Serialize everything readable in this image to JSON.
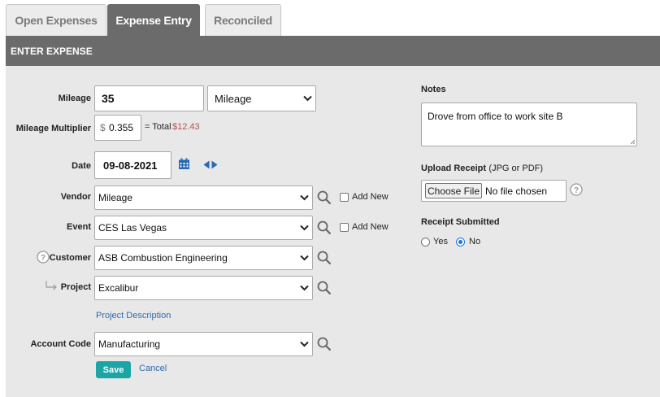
{
  "tabs": [
    {
      "label": "Open Expenses",
      "active": false
    },
    {
      "label": "Expense Entry",
      "active": true
    },
    {
      "label": "Reconciled",
      "active": false
    }
  ],
  "header": {
    "title": "ENTER EXPENSE"
  },
  "form": {
    "mileage": {
      "label": "Mileage",
      "value": "35",
      "type_value": "Mileage"
    },
    "multiplier": {
      "label": "Mileage Multiplier",
      "currency": "$",
      "value": "0.355",
      "total_label": "= Total",
      "total_value": "$12.43"
    },
    "date": {
      "label": "Date",
      "value": "09-08-2021"
    },
    "vendor": {
      "label": "Vendor",
      "value": "Mileage",
      "add_new": "Add New"
    },
    "event": {
      "label": "Event",
      "value": "CES Las Vegas",
      "add_new": "Add New"
    },
    "customer": {
      "label": "Customer",
      "value": "ASB Combustion Engineering"
    },
    "project": {
      "label": "Project",
      "value": "Excalibur",
      "description_link": "Project Description"
    },
    "account_code": {
      "label": "Account Code",
      "value": "Manufacturing"
    },
    "save_label": "Save",
    "cancel_label": "Cancel"
  },
  "side": {
    "notes_label": "Notes",
    "notes_value": "Drove from office to work site B",
    "upload_label": "Upload Receipt",
    "upload_hint": "(JPG or PDF)",
    "choose_file": "Choose File",
    "no_file": "No file chosen",
    "receipt_label": "Receipt Submitted",
    "yes_label": "Yes",
    "no_label": "No",
    "receipt_submitted": "No"
  },
  "colors": {
    "accent": "#1ba5a5",
    "header": "#6b6b6b",
    "icon_blue": "#2a6ab3",
    "total_red": "#b3544a"
  },
  "icons": [
    "calendar-icon",
    "prev-next-arrows-icon",
    "search-icon",
    "help-icon",
    "sub-item-arrow-icon"
  ]
}
